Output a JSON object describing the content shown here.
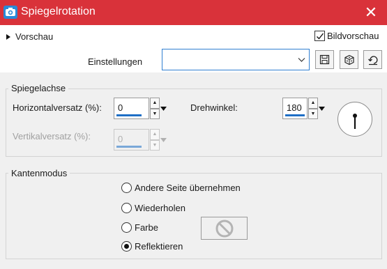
{
  "window": {
    "title": "Spiegelrotation",
    "close_glyph": "✕"
  },
  "topbar": {
    "preview_label": "Vorschau",
    "bildvorschau_label": "Bildvorschau",
    "bildvorschau_checked": true,
    "settings_label": "Einstellungen",
    "settings_value": ""
  },
  "mirror_axis": {
    "legend": "Spiegelachse",
    "horizontal_label": "Horizontalversatz (%):",
    "horizontal_value": "0",
    "vertical_label": "Vertikalversatz (%):",
    "vertical_value": "0",
    "rotation_label": "Drehwinkel:",
    "rotation_value": "180"
  },
  "edge_mode": {
    "legend": "Kantenmodus",
    "options": [
      {
        "label": "Andere Seite übernehmen",
        "selected": false
      },
      {
        "label": "Wiederholen",
        "selected": false
      },
      {
        "label": "Farbe",
        "selected": false
      },
      {
        "label": "Reflektieren",
        "selected": true
      }
    ]
  },
  "icons": {
    "app": "camera-icon",
    "save": "save-icon",
    "random": "dice-icon",
    "reset": "reset-icon",
    "no_color": "no-color-icon"
  },
  "colors": {
    "titlebar": "#d9323a",
    "accent": "#1f6fc6"
  }
}
